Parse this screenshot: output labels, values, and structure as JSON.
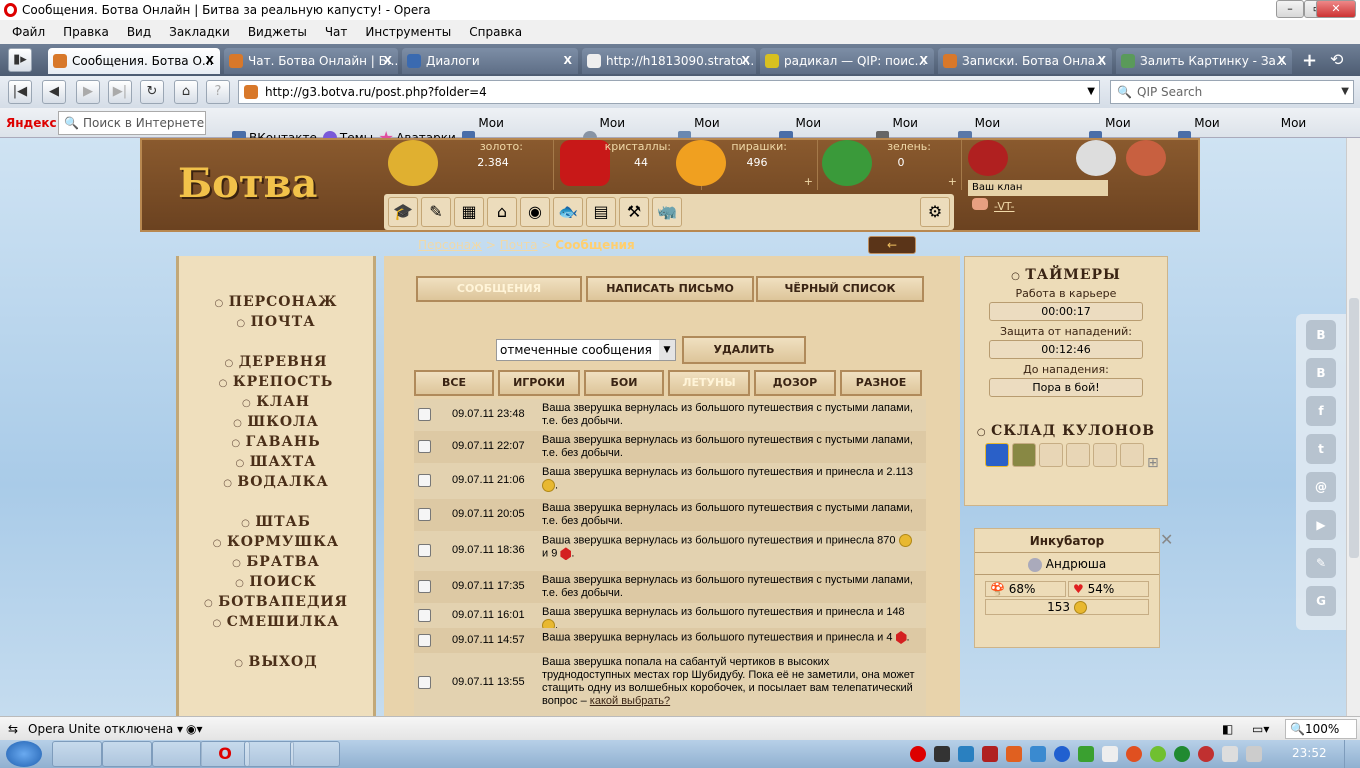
{
  "window": {
    "title": "Сообщения. Ботва Онлайн | Битва за реальную капусту! - Opera"
  },
  "menu": [
    "Файл",
    "Правка",
    "Вид",
    "Закладки",
    "Виджеты",
    "Чат",
    "Инструменты",
    "Справка"
  ],
  "tabs": [
    {
      "label": "Сообщения. Ботва О...",
      "active": true
    },
    {
      "label": "Чат. Ботва Онлайн | Б..."
    },
    {
      "label": "Диалоги"
    },
    {
      "label": "http://h1813090.strato..."
    },
    {
      "label": "радикал — QIP: поис..."
    },
    {
      "label": "Записки. Ботва Онла..."
    },
    {
      "label": "Залить Картинку - За..."
    }
  ],
  "address": {
    "url": "http://g3.botva.ru/post.php?folder=4",
    "search_placeholder": "QIP Search"
  },
  "bookmarks": {
    "yandex": "Яндекс",
    "search_placeholder": "Поиск в Интернете",
    "items": [
      "ВКонтакте",
      "Темы",
      "Аватарки",
      "Мои Сообщения",
      "Мои Друзья",
      "Мои Встречи",
      "Мои Группы",
      "Мои Фото",
      "Мои аудиозаписи",
      "Мои Видео",
      "Мои Заметки",
      "Мои Новости"
    ]
  },
  "game": {
    "logo": "Ботва ONLINE",
    "resources": [
      {
        "label": "золото:",
        "value": "2.384"
      },
      {
        "label": "кристаллы:",
        "value": "44"
      },
      {
        "label": "пирашки:",
        "value": "496"
      },
      {
        "label": "зелень:",
        "value": "0"
      }
    ],
    "clan": {
      "label": "Ваш клан",
      "name": "-VT-"
    },
    "breadcrumb": {
      "items": [
        "Персонаж",
        "Почта"
      ],
      "current": "Сообщения",
      "sep": ">"
    },
    "menu": [
      [
        "ПЕРСОНАЖ",
        "ПОЧТА"
      ],
      [
        "ДЕРЕВНЯ",
        "КРЕПОСТЬ",
        "КЛАН",
        "ШКОЛА",
        "ГАВАНЬ",
        "ШАХТА",
        "ВОДАЛКА"
      ],
      [
        "ШТАБ",
        "КОРМУШКА",
        "БРАТВА",
        "ПОИСК",
        "БОТВАПЕДИЯ",
        "СМЕШИЛКА"
      ],
      [
        "ВЫХОД"
      ]
    ],
    "mail_tabs": [
      "СООБЩЕНИЯ",
      "НАПИСАТЬ ПИСЬМО",
      "ЧЁРНЫЙ СПИСОК"
    ],
    "action_select": "отмеченные сообщения",
    "delete_label": "УДАЛИТЬ",
    "filters": [
      "ВСЕ",
      "ИГРОКИ",
      "БОИ",
      "ЛЕТУНЫ",
      "ДОЗОР",
      "РАЗНОЕ"
    ],
    "active_filter": "ЛЕТУНЫ",
    "messages": [
      {
        "date": "09.07.11 23:48",
        "text": "Ваша зверушка вернулась из большого путешествия с пустыми лапами, т.е. без добычи."
      },
      {
        "date": "09.07.11 22:07",
        "text": "Ваша зверушка вернулась из большого путешествия с пустыми лапами, т.е. без добычи."
      },
      {
        "date": "09.07.11 21:06",
        "text": "Ваша зверушка вернулась из большого путешествия и принесла и 2.113",
        "reward": "coin"
      },
      {
        "date": "09.07.11 20:05",
        "text": "Ваша зверушка вернулась из большого путешествия с пустыми лапами, т.е. без добычи."
      },
      {
        "date": "09.07.11 18:36",
        "text": "Ваша зверушка вернулась из большого путешествия и принесла 870",
        "reward": "coin",
        "text2": "и 9",
        "reward2": "gem"
      },
      {
        "date": "09.07.11 17:35",
        "text": "Ваша зверушка вернулась из большого путешествия с пустыми лапами, т.е. без добычи."
      },
      {
        "date": "09.07.11 16:01",
        "text": "Ваша зверушка вернулась из большого путешествия и принесла и 148",
        "reward": "coin"
      },
      {
        "date": "09.07.11 14:57",
        "text": "Ваша зверушка вернулась из большого путешествия и принесла и 4",
        "reward": "gem"
      },
      {
        "date": "09.07.11 13:55",
        "text": "Ваша зверушка попала на сабантуй чертиков в высоких труднодоступных местах гор Шубидубу. Пока её не заметили, она может стащить одну из волшебных коробочек, и посылает вам телепатический вопрос –",
        "link": "какой выбрать?"
      }
    ],
    "timers": {
      "title": "ТАЙМЕРЫ",
      "items": [
        {
          "label": "Работа в карьере",
          "value": "00:00:17"
        },
        {
          "label": "Защита от нападений:",
          "value": "00:12:46"
        },
        {
          "label": "До нападения:",
          "value": "Пора в бой!"
        }
      ]
    },
    "pendants": {
      "title": "СКЛАД КУЛОНОВ"
    },
    "incubator": {
      "title": "Инкубатор",
      "pet": "Андрюша",
      "stat1": "68%",
      "stat2": "54%",
      "coins": "153"
    }
  },
  "status": {
    "unite": "Opera Unite отключена",
    "zoom": "100%"
  },
  "taskbar": {
    "clock": "23:52"
  }
}
